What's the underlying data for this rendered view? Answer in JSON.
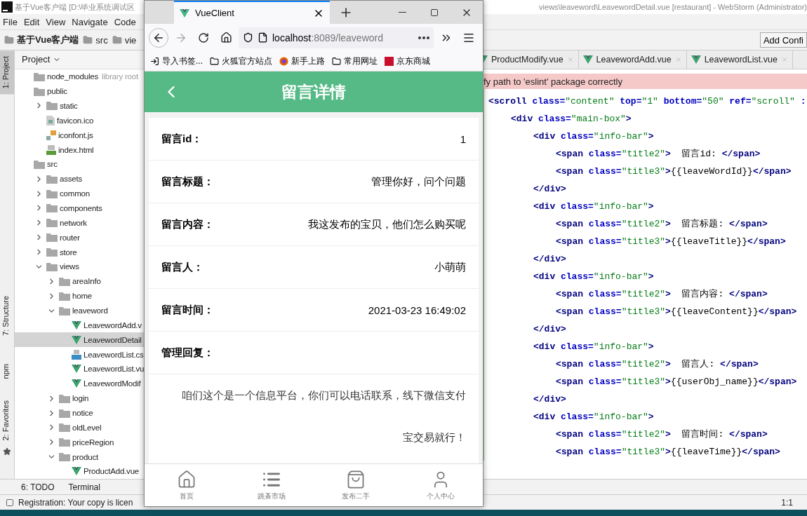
{
  "ide": {
    "title_left": "基于Vue客户端 [D:\\毕业系统调试区",
    "title_right": "views\\leaveword\\LeavewordDetail.vue [restaurant] - WebStorm (Administrator)",
    "menu": [
      "File",
      "Edit",
      "View",
      "Navigate",
      "Code"
    ],
    "breadcrumb": [
      "基于Vue客户端",
      "src",
      "vie"
    ],
    "run_config": "Add Confi",
    "side_tabs": [
      {
        "label": "1: Project",
        "selected": true
      },
      {
        "label": "7: Structure",
        "selected": false
      },
      {
        "label": "npm",
        "selected": false
      },
      {
        "label": "2: Favorites",
        "selected": false
      }
    ],
    "project_header": "Project",
    "tree": [
      {
        "name": "node_modules",
        "kind": "folder",
        "note": "library root",
        "selected": false
      },
      {
        "name": "public",
        "kind": "folder",
        "selected": false,
        "children": [
          {
            "name": "static",
            "kind": "folder",
            "expanded": false,
            "selected": false
          },
          {
            "name": "favicon.ico",
            "kind": "ico",
            "selected": false
          },
          {
            "name": "iconfont.js",
            "kind": "js",
            "selected": false
          },
          {
            "name": "index.html",
            "kind": "html",
            "selected": false
          }
        ]
      },
      {
        "name": "src",
        "kind": "folder",
        "selected": false,
        "children": [
          {
            "name": "assets",
            "kind": "folder",
            "expanded": false,
            "selected": false
          },
          {
            "name": "common",
            "kind": "folder",
            "expanded": false,
            "selected": false
          },
          {
            "name": "components",
            "kind": "folder",
            "expanded": false,
            "selected": false
          },
          {
            "name": "network",
            "kind": "folder",
            "expanded": false,
            "selected": false
          },
          {
            "name": "router",
            "kind": "folder",
            "expanded": false,
            "selected": false
          },
          {
            "name": "store",
            "kind": "folder",
            "expanded": false,
            "selected": false
          },
          {
            "name": "views",
            "kind": "folder",
            "expanded": true,
            "selected": false,
            "children": [
              {
                "name": "areaInfo",
                "kind": "folder",
                "expanded": false,
                "selected": false
              },
              {
                "name": "home",
                "kind": "folder",
                "expanded": false,
                "selected": false
              },
              {
                "name": "leaveword",
                "kind": "folder",
                "expanded": true,
                "selected": false,
                "children": [
                  {
                    "name": "LeavewordAdd.v",
                    "kind": "vue",
                    "selected": false
                  },
                  {
                    "name": "LeavewordDetail",
                    "kind": "vue",
                    "selected": true
                  },
                  {
                    "name": "LeavewordList.cs",
                    "kind": "css",
                    "selected": false
                  },
                  {
                    "name": "LeavewordList.vu",
                    "kind": "vue",
                    "selected": false
                  },
                  {
                    "name": "LeavewordModif",
                    "kind": "vue",
                    "selected": false
                  }
                ]
              },
              {
                "name": "login",
                "kind": "folder",
                "expanded": false,
                "selected": false
              },
              {
                "name": "notice",
                "kind": "folder",
                "expanded": false,
                "selected": false
              },
              {
                "name": "oldLevel",
                "kind": "folder",
                "expanded": false,
                "selected": false
              },
              {
                "name": "priceRegion",
                "kind": "folder",
                "expanded": false,
                "selected": false
              },
              {
                "name": "product",
                "kind": "folder",
                "expanded": true,
                "selected": false,
                "children": [
                  {
                    "name": "ProductAdd.vue",
                    "kind": "vue",
                    "selected": false
                  }
                ]
              }
            ]
          }
        ]
      }
    ],
    "editor_tabs": [
      {
        "label": "ProductModify.vue",
        "selected": false
      },
      {
        "label": "LeavewordAdd.vue",
        "selected": false
      },
      {
        "label": "LeavewordList.vue",
        "selected": false
      }
    ],
    "error_banner": "fy path to 'eslint' package correctly",
    "code": [
      {
        "parts": [
          {
            "kind": "tag",
            "text": "<scroll"
          },
          {
            "kind": "attr",
            "text": " class="
          },
          {
            "kind": "value",
            "text": "\"content\""
          },
          {
            "kind": "attr",
            "text": " top="
          },
          {
            "kind": "value",
            "text": "\"1\""
          },
          {
            "kind": "attr",
            "text": " bottom="
          },
          {
            "kind": "value",
            "text": "\"50\""
          },
          {
            "kind": "attr",
            "text": " ref="
          },
          {
            "kind": "value",
            "text": "\"scroll\""
          },
          {
            "kind": "attr",
            "text": " :"
          }
        ],
        "children": [
          {
            "parts": [
              {
                "kind": "tag",
                "text": "<div"
              },
              {
                "kind": "attr",
                "text": " class="
              },
              {
                "kind": "value",
                "text": "\"main-box\""
              },
              {
                "kind": "tag",
                "text": ">"
              }
            ],
            "children": [
              {
                "parts": [
                  {
                    "kind": "tag",
                    "text": "<div"
                  },
                  {
                    "kind": "attr",
                    "text": " class="
                  },
                  {
                    "kind": "value",
                    "text": "\"info-bar\""
                  },
                  {
                    "kind": "tag",
                    "text": ">"
                  }
                ],
                "children": [
                  {
                    "parts": [
                      {
                        "kind": "tag",
                        "text": "<span"
                      },
                      {
                        "kind": "attr",
                        "text": " class="
                      },
                      {
                        "kind": "value",
                        "text": "\"title2\""
                      },
                      {
                        "kind": "tag",
                        "text": ">"
                      },
                      {
                        "kind": "text",
                        "text": "  留言id: "
                      },
                      {
                        "kind": "tag",
                        "text": "</span>"
                      }
                    ]
                  },
                  {
                    "parts": [
                      {
                        "kind": "tag",
                        "text": "<span"
                      },
                      {
                        "kind": "attr",
                        "text": " class="
                      },
                      {
                        "kind": "value",
                        "text": "\"title3\""
                      },
                      {
                        "kind": "tag",
                        "text": ">"
                      },
                      {
                        "kind": "text",
                        "text": "{{leaveWordId}}"
                      },
                      {
                        "kind": "tag",
                        "text": "</span>"
                      }
                    ]
                  }
                ]
              },
              {
                "parts": [
                  {
                    "kind": "tag",
                    "text": "</div>"
                  }
                ]
              },
              {
                "parts": [
                  {
                    "kind": "tag",
                    "text": "<div"
                  },
                  {
                    "kind": "attr",
                    "text": " class="
                  },
                  {
                    "kind": "value",
                    "text": "\"info-bar\""
                  },
                  {
                    "kind": "tag",
                    "text": ">"
                  }
                ],
                "children": [
                  {
                    "parts": [
                      {
                        "kind": "tag",
                        "text": "<span"
                      },
                      {
                        "kind": "attr",
                        "text": " class="
                      },
                      {
                        "kind": "value",
                        "text": "\"title2\""
                      },
                      {
                        "kind": "tag",
                        "text": ">"
                      },
                      {
                        "kind": "text",
                        "text": "  留言标题: "
                      },
                      {
                        "kind": "tag",
                        "text": "</span>"
                      }
                    ]
                  },
                  {
                    "parts": [
                      {
                        "kind": "tag",
                        "text": "<span"
                      },
                      {
                        "kind": "attr",
                        "text": " class="
                      },
                      {
                        "kind": "value",
                        "text": "\"title3\""
                      },
                      {
                        "kind": "tag",
                        "text": ">"
                      },
                      {
                        "kind": "text",
                        "text": "{{leaveTitle}}"
                      },
                      {
                        "kind": "tag",
                        "text": "</span>"
                      }
                    ]
                  }
                ]
              },
              {
                "parts": [
                  {
                    "kind": "tag",
                    "text": "</div>"
                  }
                ]
              },
              {
                "parts": [
                  {
                    "kind": "tag",
                    "text": "<div"
                  },
                  {
                    "kind": "attr",
                    "text": " class="
                  },
                  {
                    "kind": "value",
                    "text": "\"info-bar\""
                  },
                  {
                    "kind": "tag",
                    "text": ">"
                  }
                ],
                "children": [
                  {
                    "parts": [
                      {
                        "kind": "tag",
                        "text": "<span"
                      },
                      {
                        "kind": "attr",
                        "text": " class="
                      },
                      {
                        "kind": "value",
                        "text": "\"title2\""
                      },
                      {
                        "kind": "tag",
                        "text": ">"
                      },
                      {
                        "kind": "text",
                        "text": "  留言内容: "
                      },
                      {
                        "kind": "tag",
                        "text": "</span>"
                      }
                    ]
                  },
                  {
                    "parts": [
                      {
                        "kind": "tag",
                        "text": "<span"
                      },
                      {
                        "kind": "attr",
                        "text": " class="
                      },
                      {
                        "kind": "value",
                        "text": "\"title3\""
                      },
                      {
                        "kind": "tag",
                        "text": ">"
                      },
                      {
                        "kind": "text",
                        "text": "{{leaveContent}}"
                      },
                      {
                        "kind": "tag",
                        "text": "</span>"
                      }
                    ]
                  }
                ]
              },
              {
                "parts": [
                  {
                    "kind": "tag",
                    "text": "</div>"
                  }
                ]
              },
              {
                "parts": [
                  {
                    "kind": "tag",
                    "text": "<div"
                  },
                  {
                    "kind": "attr",
                    "text": " class="
                  },
                  {
                    "kind": "value",
                    "text": "\"info-bar\""
                  },
                  {
                    "kind": "tag",
                    "text": ">"
                  }
                ],
                "children": [
                  {
                    "parts": [
                      {
                        "kind": "tag",
                        "text": "<span"
                      },
                      {
                        "kind": "attr",
                        "text": " class="
                      },
                      {
                        "kind": "value",
                        "text": "\"title2\""
                      },
                      {
                        "kind": "tag",
                        "text": ">"
                      },
                      {
                        "kind": "text",
                        "text": "  留言人: "
                      },
                      {
                        "kind": "tag",
                        "text": "</span>"
                      }
                    ]
                  },
                  {
                    "parts": [
                      {
                        "kind": "tag",
                        "text": "<span"
                      },
                      {
                        "kind": "attr",
                        "text": " class="
                      },
                      {
                        "kind": "value",
                        "text": "\"title3\""
                      },
                      {
                        "kind": "tag",
                        "text": ">"
                      },
                      {
                        "kind": "text",
                        "text": "{{userObj_name}}"
                      },
                      {
                        "kind": "tag",
                        "text": "</span>"
                      }
                    ]
                  }
                ]
              },
              {
                "parts": [
                  {
                    "kind": "tag",
                    "text": "</div>"
                  }
                ]
              },
              {
                "parts": [
                  {
                    "kind": "tag",
                    "text": "<div"
                  },
                  {
                    "kind": "attr",
                    "text": " class="
                  },
                  {
                    "kind": "value",
                    "text": "\"info-bar\""
                  },
                  {
                    "kind": "tag",
                    "text": ">"
                  }
                ],
                "children": [
                  {
                    "parts": [
                      {
                        "kind": "tag",
                        "text": "<span"
                      },
                      {
                        "kind": "attr",
                        "text": " class="
                      },
                      {
                        "kind": "value",
                        "text": "\"title2\""
                      },
                      {
                        "kind": "tag",
                        "text": ">"
                      },
                      {
                        "kind": "text",
                        "text": "  留言时间: "
                      },
                      {
                        "kind": "tag",
                        "text": "</span>"
                      }
                    ]
                  },
                  {
                    "parts": [
                      {
                        "kind": "tag",
                        "text": "<span"
                      },
                      {
                        "kind": "attr",
                        "text": " class="
                      },
                      {
                        "kind": "value",
                        "text": "\"title3\""
                      },
                      {
                        "kind": "tag",
                        "text": ">"
                      },
                      {
                        "kind": "text",
                        "text": "{{leaveTime}}"
                      },
                      {
                        "kind": "tag",
                        "text": "</span>"
                      }
                    ]
                  }
                ]
              }
            ]
          }
        ]
      }
    ],
    "bottom_tabs": [
      "6: TODO",
      "Terminal"
    ],
    "status": "Registration: Your copy is licen",
    "cursor": "1:1"
  },
  "browser": {
    "tab_title": "VueClient",
    "url_host": "localhost",
    "url_rest": ":8089/leaveword",
    "bookmarks": [
      "导入书签...",
      "火狐官方站点",
      "新手上路",
      "常用网址",
      "京东商城"
    ],
    "page": {
      "title": "留言详情",
      "rows": [
        {
          "label": "留言id：",
          "value": "1"
        },
        {
          "label": "留言标题：",
          "value": "管理你好，问个问题"
        },
        {
          "label": "留言内容：",
          "value": "我这发布的宝贝，他们怎么购买呢"
        },
        {
          "label": "留言人：",
          "value": "小萌萌"
        },
        {
          "label": "留言时间：",
          "value": "2021-03-23 16:49:02"
        },
        {
          "label": "管理回复："
        }
      ],
      "reply": "咱们这个是一个信息平台，你们可以电话联系，线下微信支付宝交易就行！",
      "tabbar": [
        {
          "label": "首页",
          "kind": "home"
        },
        {
          "label": "跳蚤市场",
          "kind": "list"
        },
        {
          "label": "发布二手",
          "kind": "bag"
        },
        {
          "label": "个人中心",
          "kind": "user"
        }
      ]
    }
  }
}
